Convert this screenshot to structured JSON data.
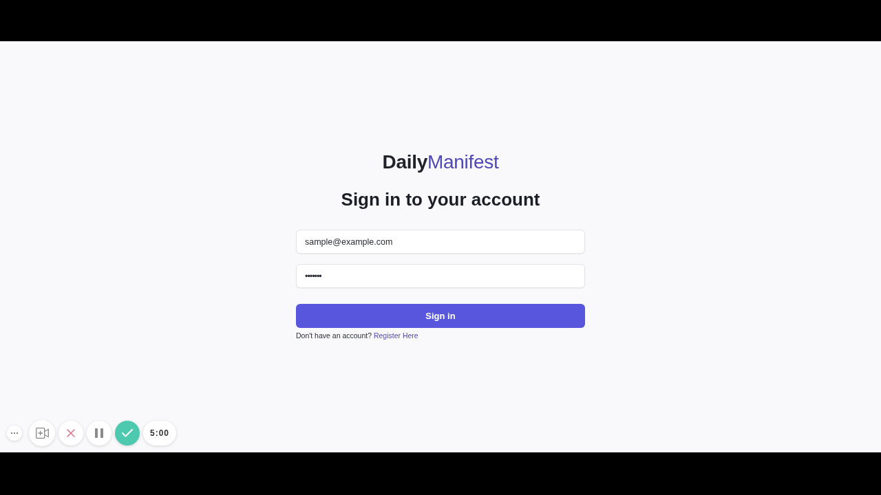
{
  "logo": {
    "parts": [
      {
        "text": "Daily",
        "kind": "bold"
      },
      {
        "text": "Manifest",
        "kind": "light"
      }
    ]
  },
  "heading": "Sign in to your account",
  "fields": [
    {
      "kind": "email",
      "value": "sample@example.com"
    },
    {
      "kind": "password",
      "value": "•••••••"
    }
  ],
  "submit_button": "Sign in",
  "register": {
    "prompt": "Don't have an account?",
    "link": "Register Here"
  },
  "recorder": {
    "timer": "5:00"
  }
}
